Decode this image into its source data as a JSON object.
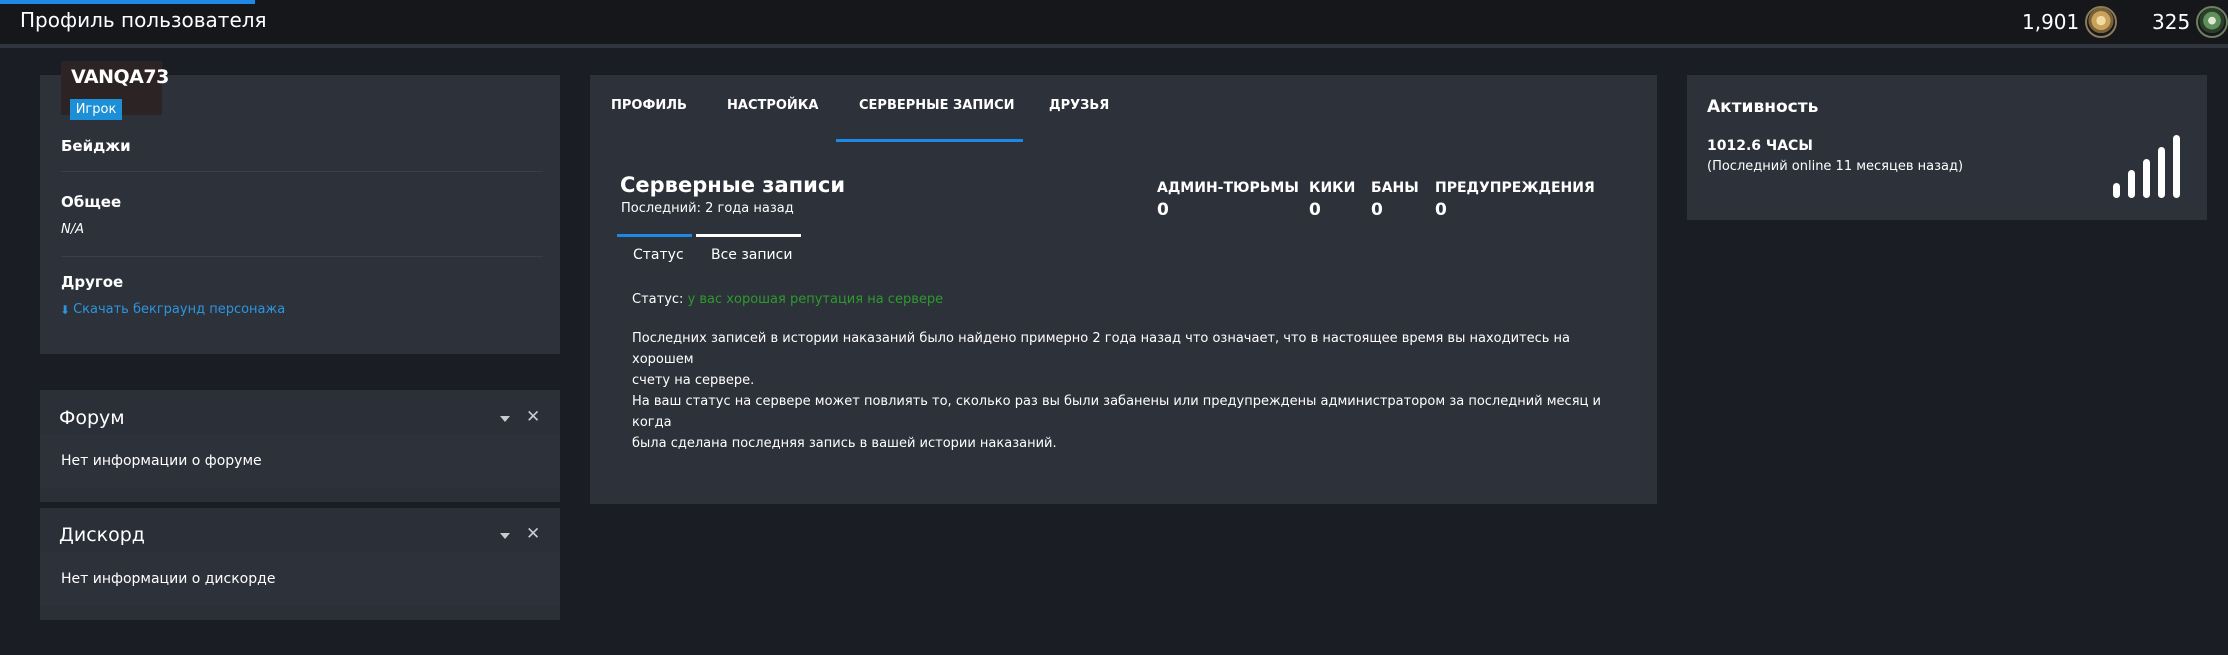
{
  "header": {
    "title": "Профиль пользователя",
    "currency1": {
      "value": "1,901",
      "icon": "gold-medal-icon"
    },
    "currency2": {
      "value": "325",
      "icon": "green-coin-icon"
    }
  },
  "profile": {
    "username": "VANQA73",
    "role": "Игрок",
    "badges_label": "Бейджи",
    "general_label": "Общее",
    "general_value": "N/A",
    "other_label": "Другое",
    "download_link": "Скачать бекграунд персонажа"
  },
  "forum": {
    "title": "Форум",
    "text": "Нет информации о форуме"
  },
  "discord": {
    "title": "Дискорд",
    "text": "Нет информации о дискорде"
  },
  "tabs": [
    "ПРОФИЛЬ",
    "НАСТРОЙКА",
    "СЕРВЕРНЫЕ ЗАПИСИ",
    "ДРУЗЬЯ"
  ],
  "records": {
    "title": "Серверные записи",
    "subtitle": "Последний: 2 года назад",
    "stats": [
      {
        "label": "АДМИН-ТЮРЬМЫ",
        "value": "0"
      },
      {
        "label": "КИКИ",
        "value": "0"
      },
      {
        "label": "БАНЫ",
        "value": "0"
      },
      {
        "label": "ПРЕДУПРЕЖДЕНИЯ",
        "value": "0"
      }
    ],
    "subtabs": [
      "Статус",
      "Все записи"
    ],
    "status_label": "Статус:",
    "status_value": "у вас хорошая репутация на сервере",
    "para1_line1": "Последних записей в истории наказаний было найдено примерно 2 года назад что означает, что в настоящее время вы находитесь на хорошем",
    "para1_line2": "счету на сервере.",
    "para2_line1": "На ваш статус на сервере может повлиять то, сколько раз вы были забанены или предупреждены администратором за последний месяц и когда",
    "para2_line2": "была сделана последняя запись в вашей истории наказаний."
  },
  "activity": {
    "title": "Активность",
    "hours": "1012.6 ЧАСЫ",
    "last_online": "(Последний online 11 месяцев назад)"
  },
  "colors": {
    "accent": "#1e88e5",
    "good": "#2e9a2e",
    "badge": "#1d8fd6"
  }
}
